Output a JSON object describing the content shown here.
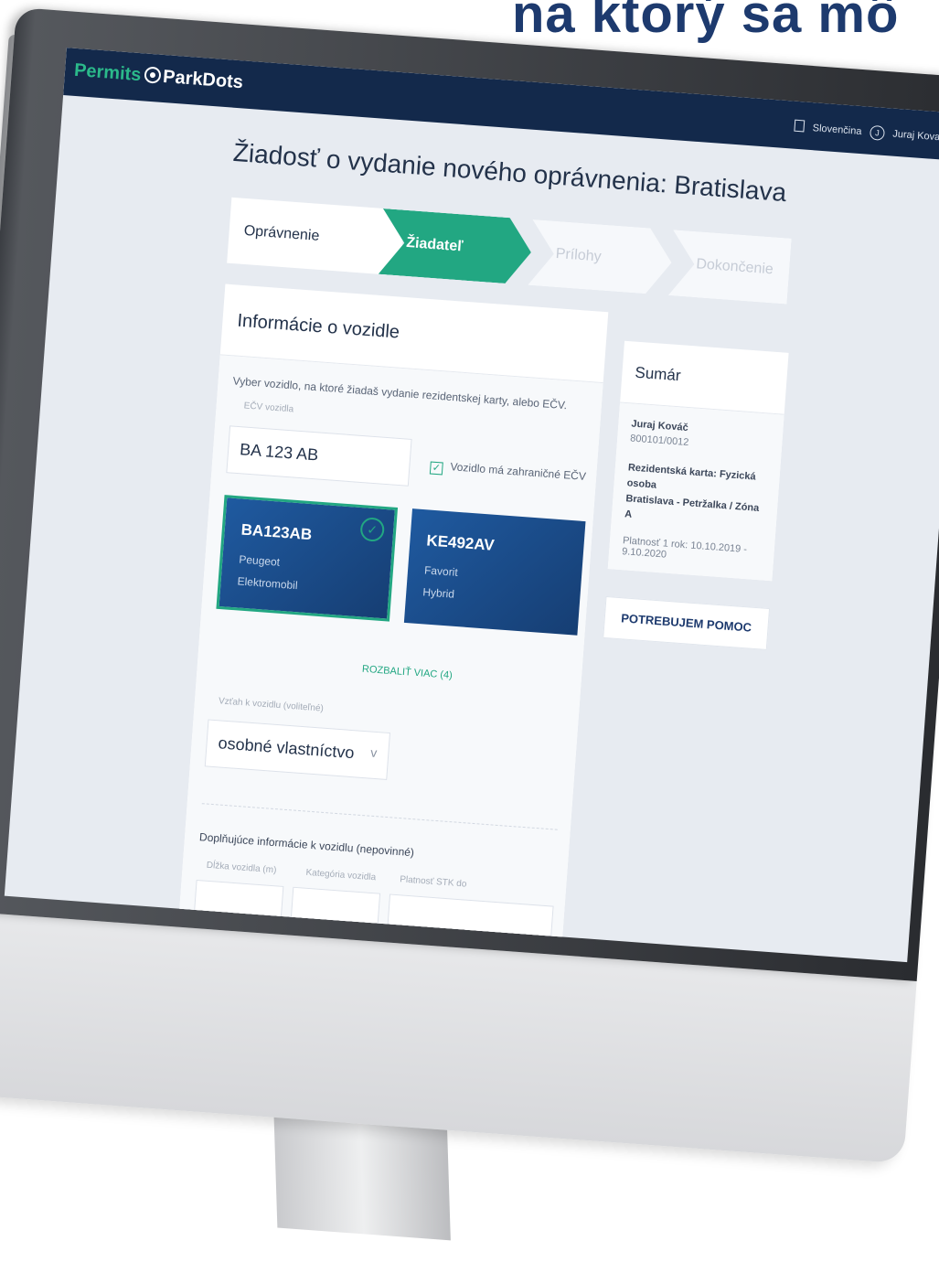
{
  "headline": "na ktorý sa mô",
  "app": {
    "brand_left": "Permits",
    "brand_right": "ParkDots",
    "language": "Slovenčina",
    "user_initial": "J",
    "user_name": "Juraj Kovac"
  },
  "page": {
    "title": "Žiadosť o vydanie nového oprávnenia: Bratislava"
  },
  "steps": [
    {
      "label": "Oprávnenie"
    },
    {
      "label": "Žiadateľ"
    },
    {
      "label": "Prílohy"
    },
    {
      "label": "Dokončenie"
    }
  ],
  "vehicle": {
    "section_title": "Informácie o vozidle",
    "instruction": "Vyber vozidlo, na ktoré žiadaš vydanie rezidentskej karty, alebo EČV.",
    "plate_label": "EČV vozidla",
    "plate_value": "BA 123 AB",
    "foreign_plate_label": "Vozidlo má zahraničné EČV",
    "cards": [
      {
        "plate": "BA123AB",
        "brand": "Peugeot",
        "fuel": "Elektromobil"
      },
      {
        "plate": "KE492AV",
        "brand": "Favorit",
        "fuel": "Hybrid"
      }
    ],
    "expand_label": "ROZBALIŤ VIAC (4)",
    "relation_label": "Vzťah k vozidlu (voliteľné)",
    "relation_value": "osobné vlastníctvo",
    "additional_title": "Doplňujúce informácie k vozidlu (nepovinné)",
    "length_label": "Dĺžka vozidla (m)",
    "category_label": "Kategória vozidla",
    "stk_label": "Platnosť STK do"
  },
  "summary": {
    "title": "Sumár",
    "name": "Juraj Kováč",
    "id": "800101/0012",
    "card_type": "Rezidentská karta: Fyzická osoba",
    "zone": "Bratislava - Petržalka / Zóna A",
    "validity": "Platnosť 1 rok: 10.10.2019 - 9.10.2020",
    "help_button": "POTREBUJEM POMOC"
  }
}
